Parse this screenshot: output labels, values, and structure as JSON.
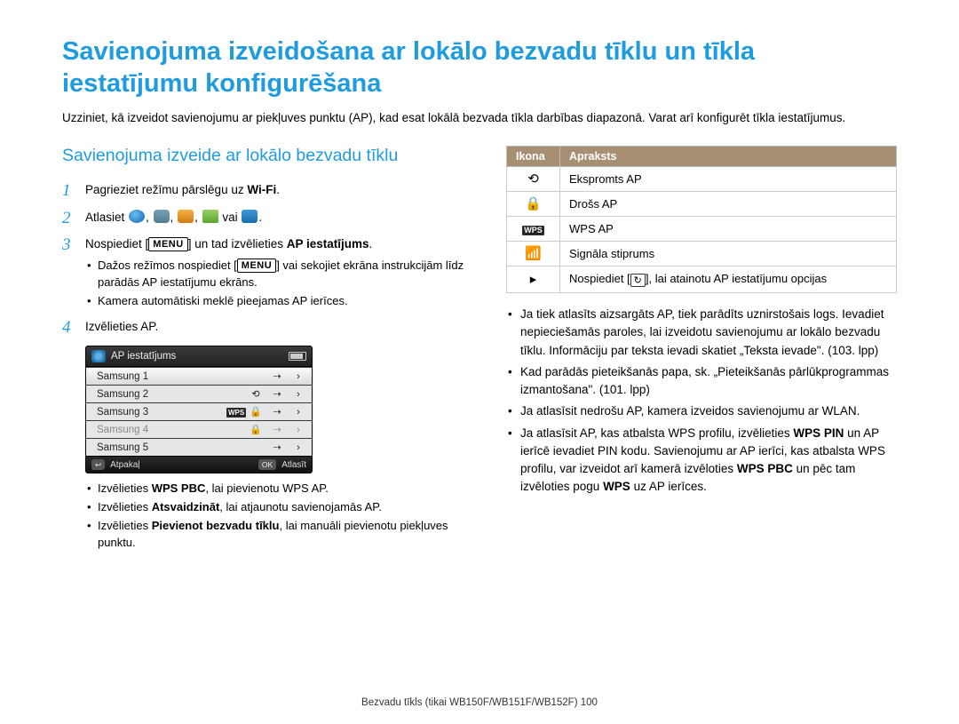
{
  "title": "Savienojuma izveidošana ar lokālo bezvadu tīklu un tīkla iestatījumu konfigurēšana",
  "intro": "Uzziniet, kā izveidot savienojumu ar piekļuves punktu (AP), kad esat lokālā bezvada tīkla darbības diapazonā. Varat arī konfigurēt tīkla iestatījumus.",
  "subtitle": "Savienojuma izveide ar lokālo bezvadu tīklu",
  "steps": {
    "s1_a": "Pagrieziet režīmu pārslēgu uz ",
    "s1_b": "Wi-Fi",
    "s1_c": ".",
    "s2_a": "Atlasiet ",
    "s2_sep": ", ",
    "s2_or": " vai ",
    "s2_end": ".",
    "s3_a": "Nospiediet [",
    "s3_menu": "MENU",
    "s3_b": "] un tad izvēlieties ",
    "s3_bold": "AP iestatījums",
    "s3_c": ".",
    "s3_sub1_a": "Dažos režīmos nospiediet [",
    "s3_sub1_b": "] vai sekojiet ekrāna instrukcijām līdz parādās AP iestatījumu ekrāns.",
    "s3_sub2": "Kamera automātiski meklē pieejamas AP ierīces.",
    "s4": "Izvēlieties AP."
  },
  "ap_shot": {
    "title": "AP iestatījums",
    "rows": [
      "Samsung 1",
      "Samsung 2",
      "Samsung 3",
      "Samsung 4",
      "Samsung 5"
    ],
    "back": "Atpakaļ",
    "ok": "OK",
    "select": "Atlasīt"
  },
  "after": {
    "b1_a": "Izvēlieties ",
    "b1_bold": "WPS PBC",
    "b1_b": ", lai pievienotu WPS AP.",
    "b2_a": "Izvēlieties ",
    "b2_bold": "Atsvaidzināt",
    "b2_b": ", lai atjaunotu savienojamās AP.",
    "b3_a": "Izvēlieties ",
    "b3_bold": "Pievienot bezvadu tīklu",
    "b3_b": ", lai manuāli pievienotu piekļuves punktu."
  },
  "table": {
    "h1": "Ikona",
    "h2": "Apraksts",
    "r1": "Ekspromts AP",
    "r2": "Drošs AP",
    "r3": "WPS AP",
    "r4": "Signāla stiprums",
    "r5_a": "Nospiediet [",
    "r5_icon": "↻",
    "r5_b": "], lai atainotu AP iestatījumu opcijas"
  },
  "right_bullets": {
    "b1": "Ja tiek atlasīts aizsargāts AP, tiek parādīts uznirstošais logs. Ievadiet nepieciešamās paroles, lai izveidotu savienojumu ar lokālo bezvadu tīklu. Informāciju par teksta ievadi skatiet „Teksta ievade\". (103. lpp)",
    "b2": "Kad parādās pieteikšanās papa, sk. „Pieteikšanās pārlūkprogrammas izmantošana\". (101. lpp)",
    "b3": "Ja atlasīsit nedrošu AP, kamera izveidos savienojumu ar WLAN.",
    "b4_a": "Ja atlasīsit AP, kas atbalsta WPS profilu, izvēlieties ",
    "b4_bold1": "WPS PIN",
    "b4_b": " un AP ierīcē ievadiet PIN kodu. Savienojumu ar AP ierīci, kas atbalsta WPS profilu, var izveidot arī kamerā izvēloties ",
    "b4_bold2": "WPS PBC",
    "b4_c": " un pēc tam izvēloties pogu ",
    "b4_bold3": "WPS",
    "b4_d": " uz AP ierīces."
  },
  "footer_a": "Bezvadu tīkls (tikai WB150F/WB151F/WB152F)  ",
  "footer_page": "100"
}
